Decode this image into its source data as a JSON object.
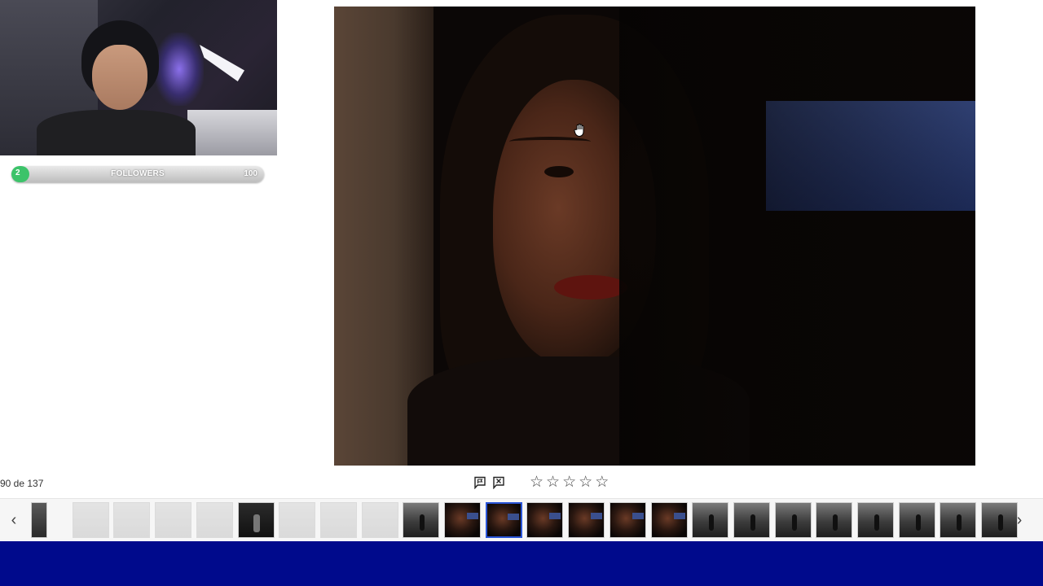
{
  "webcam": {
    "label": "streamer webcam overlay"
  },
  "followers": {
    "current": "2",
    "label": "FOLLOWERS",
    "goal": "100",
    "progress_fraction": 0.02
  },
  "viewer": {
    "counter": "90 de 137"
  },
  "toolbar": {
    "flag_icon": "flag-pick-icon",
    "reject_icon": "flag-reject-icon",
    "rating_stars": [
      "☆",
      "☆",
      "☆",
      "☆",
      "☆"
    ],
    "rating_value": 0
  },
  "filmstrip": {
    "prev": "‹",
    "next": "›",
    "thumbnails": [
      {
        "style": "mid"
      },
      {
        "style": "faded"
      },
      {
        "style": "faded"
      },
      {
        "style": "faded"
      },
      {
        "style": "faded"
      },
      {
        "style": "dark"
      },
      {
        "style": "faded"
      },
      {
        "style": "faded"
      },
      {
        "style": "faded"
      },
      {
        "style": "street"
      },
      {
        "style": "portrait"
      },
      {
        "style": "portrait",
        "selected": true
      },
      {
        "style": "portrait"
      },
      {
        "style": "portrait"
      },
      {
        "style": "portrait"
      },
      {
        "style": "portrait"
      },
      {
        "style": "street"
      },
      {
        "style": "street"
      },
      {
        "style": "street"
      },
      {
        "style": "street"
      },
      {
        "style": "street"
      },
      {
        "style": "street"
      },
      {
        "style": "street"
      },
      {
        "style": "street"
      }
    ]
  },
  "colors": {
    "banner": "#000a8c",
    "selection": "#2b56d8",
    "progress": "#3cc36a"
  }
}
